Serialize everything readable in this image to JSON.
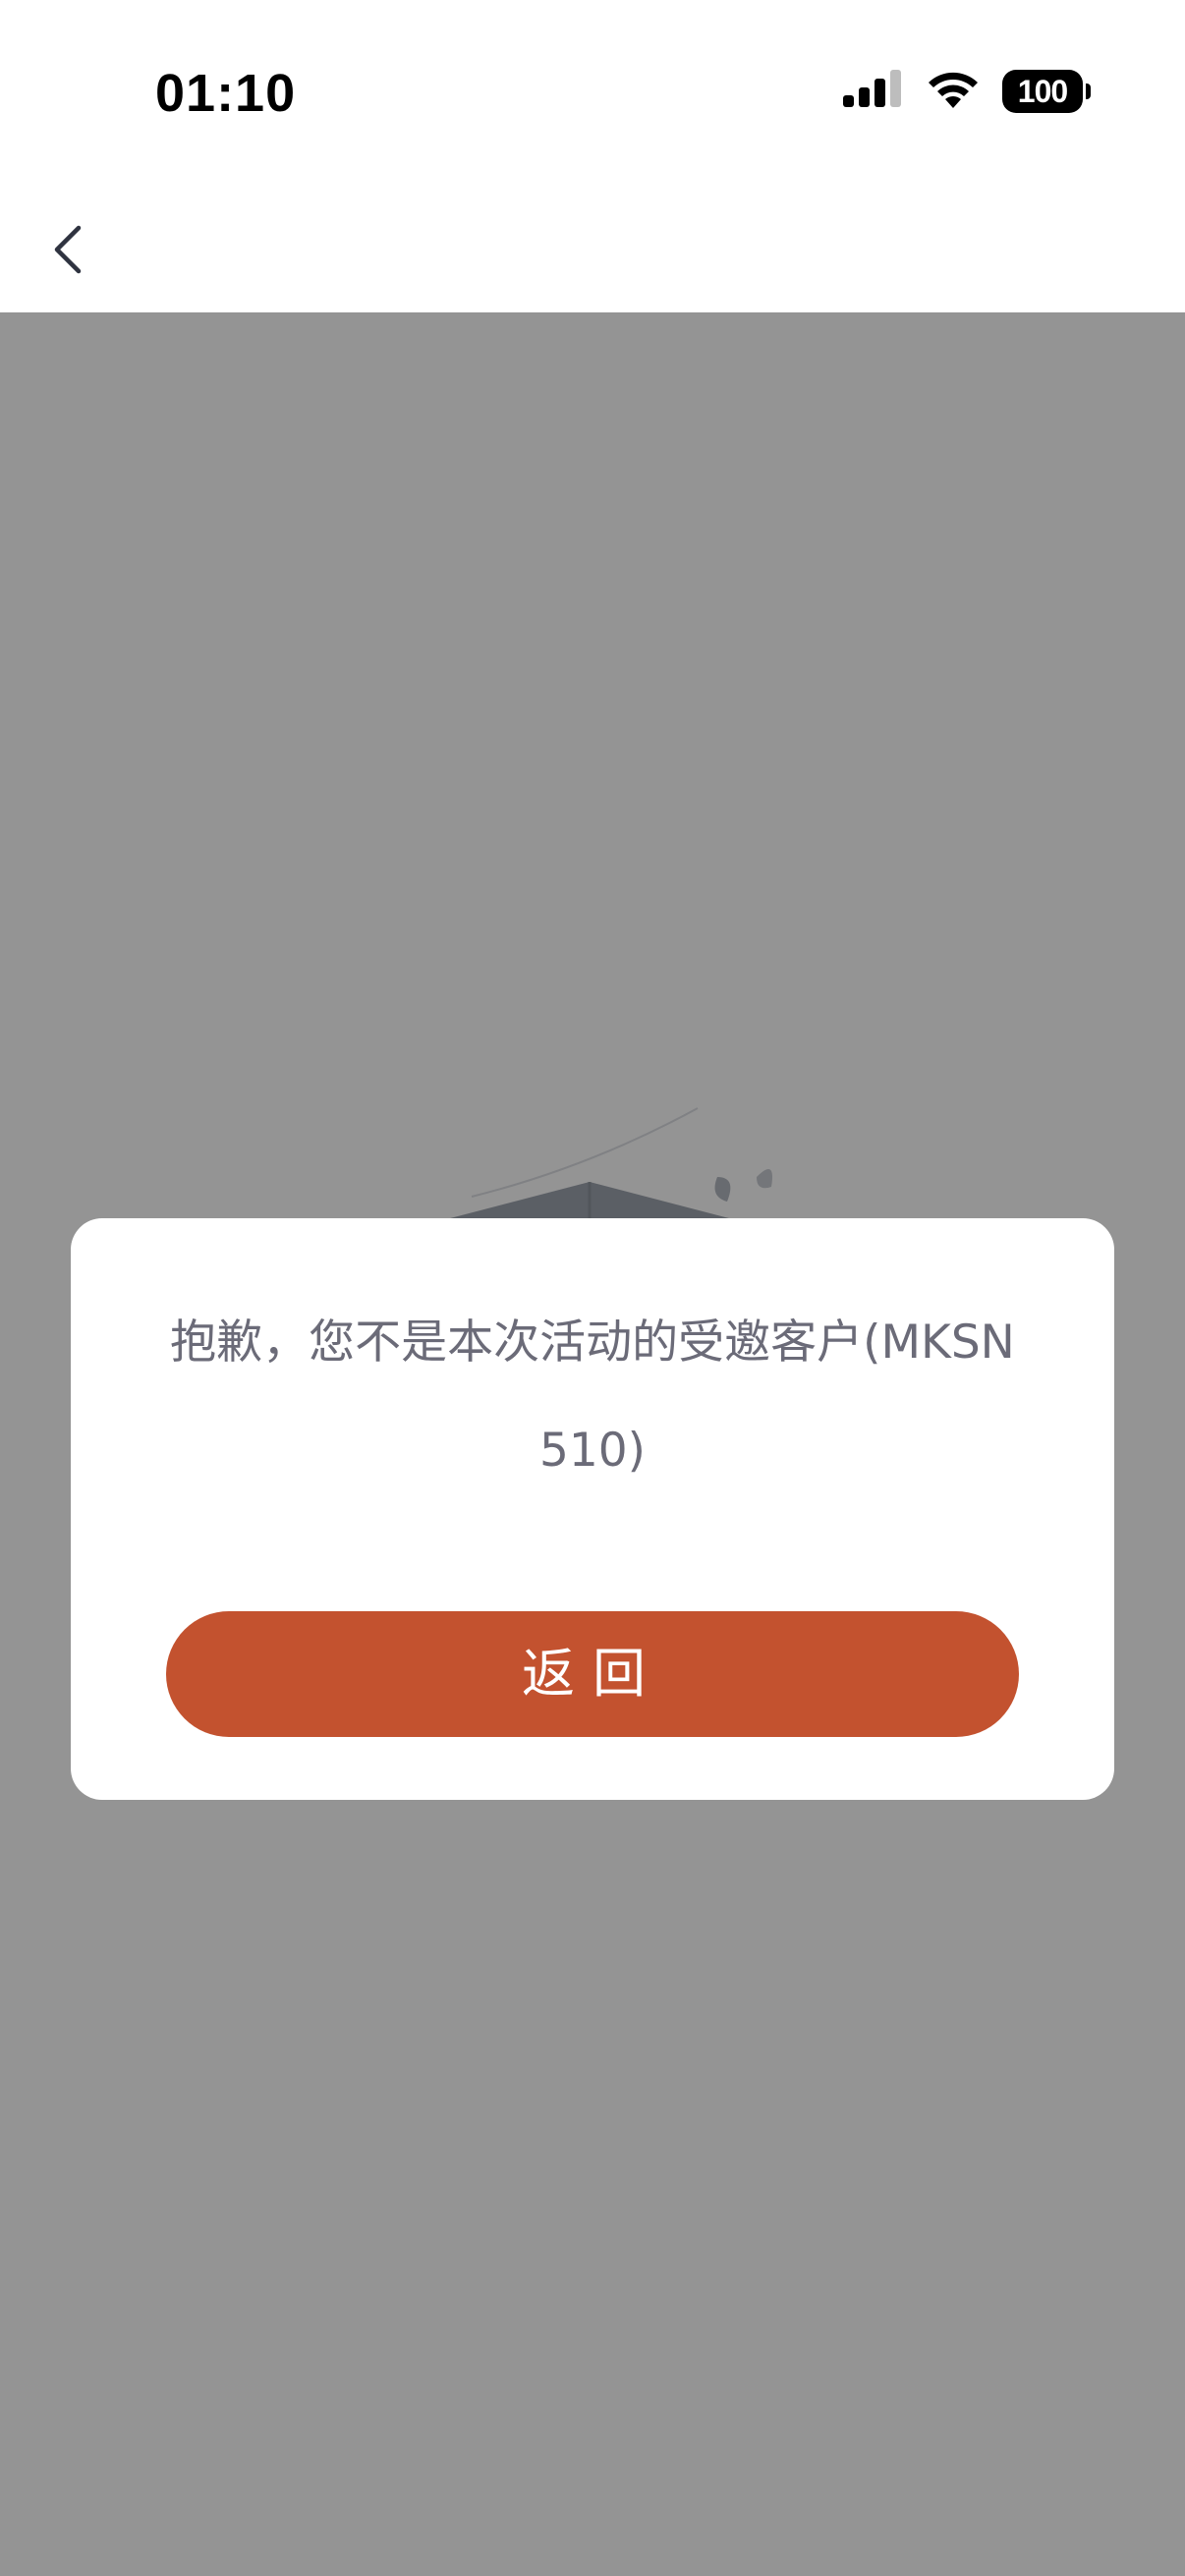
{
  "status_bar": {
    "time": "01:10",
    "battery": "100",
    "icons": [
      "cellular-signal-icon",
      "wifi-icon",
      "battery-icon"
    ]
  },
  "nav": {
    "back_icon": "chevron-left-icon"
  },
  "illustration": {
    "icon": "empty-box-illustration"
  },
  "dialog": {
    "message": "抱歉，您不是本次活动的受邀客户(MKSN510)",
    "button_label": "返回"
  },
  "colors": {
    "accent": "#c3522f",
    "overlay": "rgba(0,0,0,0.42)",
    "message_text": "#6b6b78"
  }
}
